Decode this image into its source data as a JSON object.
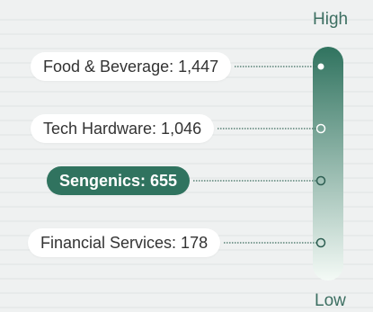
{
  "chart_data": {
    "type": "gradient-scale",
    "scale_high_label": "High",
    "scale_low_label": "Low",
    "items": [
      {
        "label": "Food & Beverage: 1,447",
        "name": "Food & Beverage",
        "value": 1447,
        "highlight": false
      },
      {
        "label": "Tech Hardware: 1,046",
        "name": "Tech Hardware",
        "value": 1046,
        "highlight": false
      },
      {
        "label": "Sengenics: 655",
        "name": "Sengenics",
        "value": 655,
        "highlight": true
      },
      {
        "label": "Financial Services: 178",
        "name": "Financial Services",
        "value": 178,
        "highlight": false
      }
    ],
    "colors": {
      "background": "#eff1f1",
      "gradient_top": "#30735f",
      "gradient_bottom": "#f4faf6",
      "highlight": "#30735f",
      "connector": "#3a6b5e",
      "gridline": "#dfe3e3"
    }
  }
}
